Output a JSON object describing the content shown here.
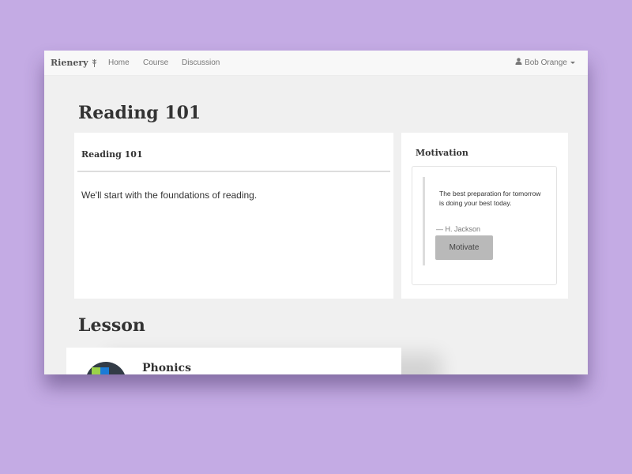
{
  "navbar": {
    "brand": "Rienery",
    "links": [
      "Home",
      "Course",
      "Discussion"
    ],
    "user_name": "Bob Orange"
  },
  "page": {
    "title": "Reading 101"
  },
  "course_panel": {
    "heading": "Reading 101",
    "body": "We'll start with the foundations of reading."
  },
  "motivation": {
    "heading": "Motivation",
    "quote": "The best preparation for tomorrow is doing your best today.",
    "author": "— H. Jackson",
    "button_label": "Motivate"
  },
  "lesson_section": {
    "title": "Lesson",
    "items": [
      {
        "title": "Phonics",
        "icon": "lesson-logo"
      }
    ]
  },
  "colors": {
    "background": "#c4abe4",
    "window": "#f0f0f0",
    "navbar": "#f8f8f8",
    "button": "#b9b9b9",
    "avatar": "#333c47",
    "avatar_green": "#9bd24a",
    "avatar_blue": "#1b7bd6"
  }
}
